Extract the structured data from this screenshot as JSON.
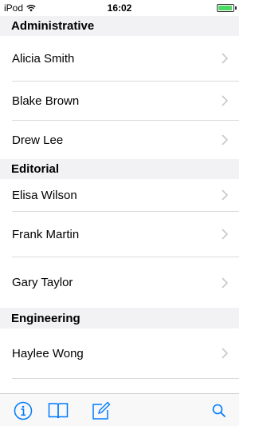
{
  "status_bar": {
    "carrier": "iPod",
    "time": "16:02"
  },
  "sections": [
    {
      "title": "Administrative",
      "items": [
        "Alicia Smith",
        "Blake Brown",
        "Drew Lee"
      ]
    },
    {
      "title": "Editorial",
      "items": [
        "Elisa Wilson",
        "Frank Martin",
        "Gary Taylor"
      ]
    },
    {
      "title": "Engineering",
      "items": [
        "Haylee Wong"
      ]
    }
  ],
  "colors": {
    "accent": "#007aff",
    "battery": "#4cd964",
    "section_bg": "#f2f2f4"
  },
  "toolbar": {
    "icons": [
      "info-icon",
      "book-icon",
      "compose-icon",
      "search-icon"
    ]
  }
}
